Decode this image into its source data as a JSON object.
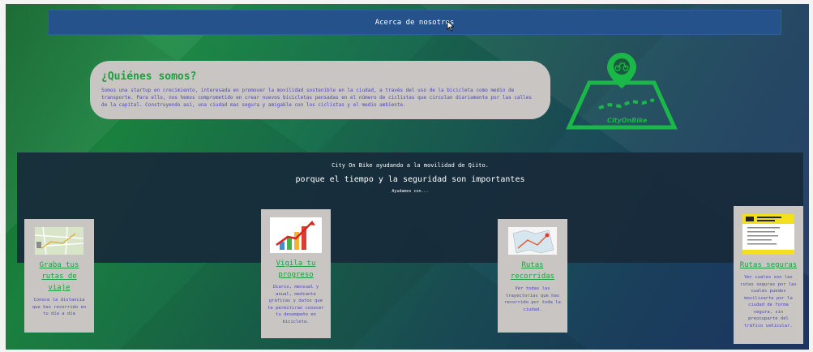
{
  "nav": {
    "link": "Acerca de nosotros"
  },
  "about": {
    "title": "¿Quiénes somos?",
    "text": "Somos una startup en crecimiento, interesada en promover la movilidad sostenible en la ciudad, a través del uso de la bicicleta como medio de transporte. Para ello, nos hemos comprometido en crear nuevos bicicletas pensadas en el número de ciclistas que circulan diariamente por las calles de la capital. Construyendo así, una ciudad mas segura y amigable con los ciclistas y el medio ambiente."
  },
  "logo": {
    "name": "CityOnBike"
  },
  "band": {
    "line1": "City On Bike ayudando a la movilidad de Qiito.",
    "line2": "porque el tiempo y la seguridad son importantes",
    "line3": "Ayudamos con..."
  },
  "cards": [
    {
      "title": "Graba tus rutas de viaje",
      "text": "Conoce la distancia que has recorrido en tu día a día",
      "image": "route-map-image"
    },
    {
      "title": "Vigila tu progreso",
      "text": "Diario, mensual y anual, mediante gráficas y datos que te permitiran conocer tu desempeño en bicicleta.",
      "image": "progress-chart-image"
    },
    {
      "title": "Rutas recorridas",
      "text": "Ver todas las trayectorias que has recorrido por toda la ciudad.",
      "image": "folded-map-image"
    },
    {
      "title": "Rutas seguras",
      "text": "Ver cuales son las rutas seguras por las cuales puedes movilizarte por la ciudad de forma segura, sin preocuparte del tráfico vehicular.",
      "image": "safe-route-document-image"
    }
  ],
  "colors": {
    "green": "#1f9e41",
    "nav": "#25528a",
    "text_blue": "#4b49b8",
    "card_bg": "#c9c5c3"
  }
}
